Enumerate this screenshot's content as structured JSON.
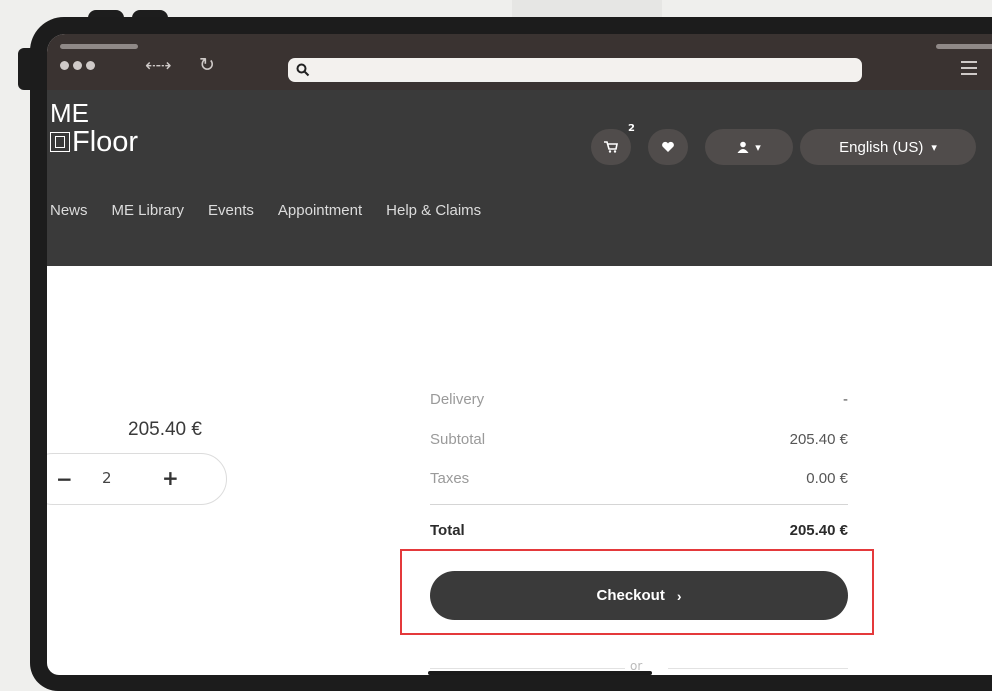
{
  "browser": {
    "search_icon": "search-icon",
    "url": ""
  },
  "header": {
    "logo_line1": "ME",
    "logo_line2": "Floor",
    "cart_count": "2",
    "language": "English (US)"
  },
  "nav": {
    "items": [
      "News",
      "ME Library",
      "Events",
      "Appointment",
      "Help & Claims"
    ]
  },
  "product": {
    "price": "205.40 €",
    "quantity": "2",
    "minus": "−",
    "plus": "+"
  },
  "summary": {
    "delivery_label": "Delivery",
    "delivery_value": "-",
    "subtotal_label": "Subtotal",
    "subtotal_value": "205.40 €",
    "taxes_label": "Taxes",
    "taxes_value": "0.00 €",
    "total_label": "Total",
    "total_value": "205.40 €",
    "checkout_label": "Checkout",
    "or_label": "or"
  },
  "colors": {
    "header_bg": "#3a3a3a",
    "chrome_bg": "#3a3331",
    "highlight": "#e4393b"
  }
}
